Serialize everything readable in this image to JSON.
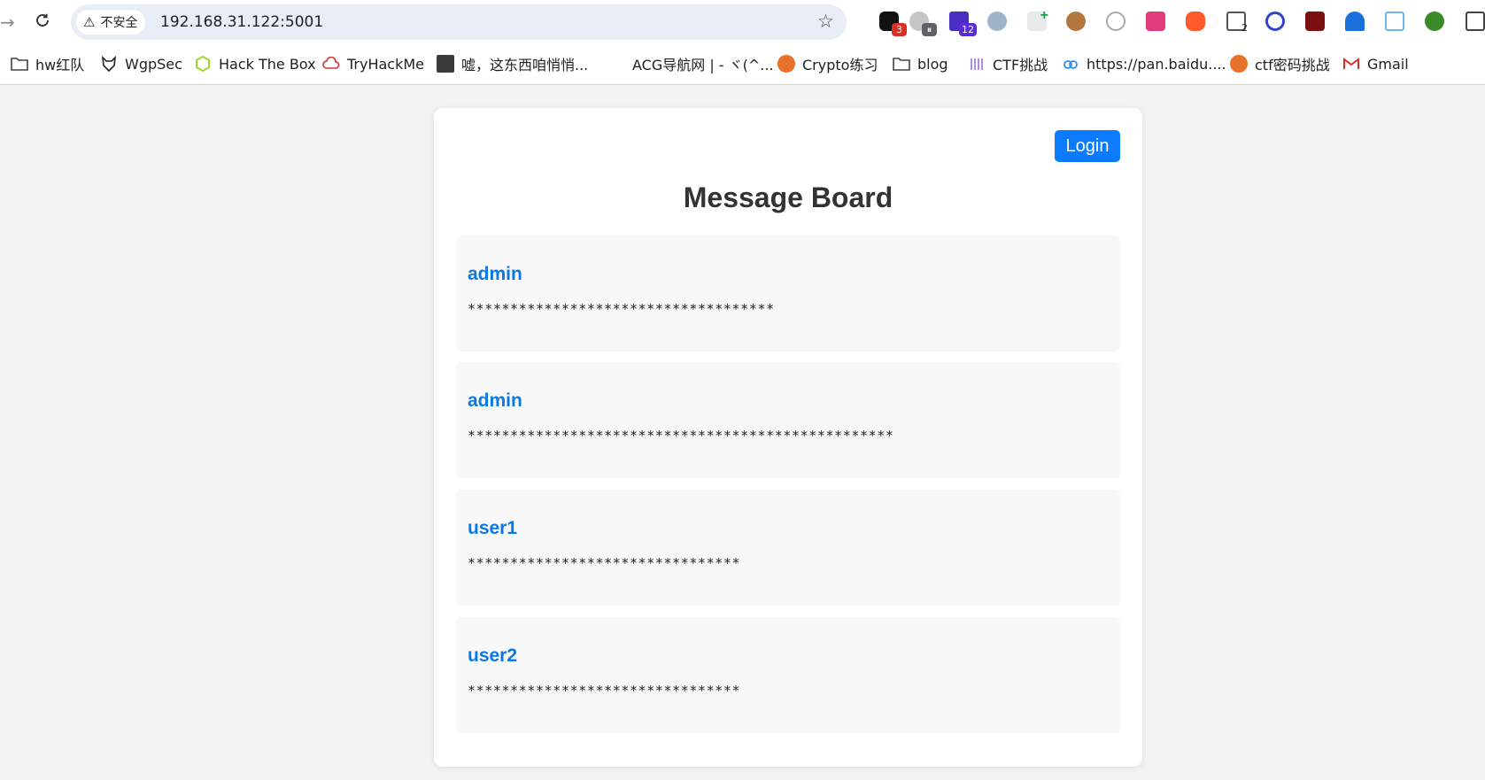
{
  "browser": {
    "security_label": "不安全",
    "url": "192.168.31.122:5001",
    "extensions": [
      {
        "name": "ext-1",
        "badge": "3",
        "badge_color": "#d93025"
      },
      {
        "name": "ext-2",
        "badge": "⏸",
        "badge_color": "#5f6368"
      },
      {
        "name": "ext-3",
        "badge": "12",
        "badge_color": "#5b2bd6"
      }
    ]
  },
  "bookmarks": [
    {
      "label": "hw红队",
      "icon": "folder-icon"
    },
    {
      "label": "WgpSec",
      "icon": "wolf-icon"
    },
    {
      "label": "Hack The Box",
      "icon": "cube-icon"
    },
    {
      "label": "TryHackMe",
      "icon": "cloud-icon"
    },
    {
      "label": "嘘，这东西咱悄悄...",
      "icon": "page-icon"
    },
    {
      "label": "ACG导航网 | - ヾ(^...",
      "icon": ""
    },
    {
      "label": "Crypto练习",
      "icon": "brain-icon"
    },
    {
      "label": "blog",
      "icon": "folder-icon"
    },
    {
      "label": "CTF挑战",
      "icon": "bars-icon"
    },
    {
      "label": "https://pan.baidu....",
      "icon": "baidu-pan-icon"
    },
    {
      "label": "ctf密码挑战",
      "icon": "brain-icon"
    },
    {
      "label": "Gmail",
      "icon": "gmail-icon"
    }
  ],
  "page": {
    "login_label": "Login",
    "title": "Message Board",
    "messages": [
      {
        "user": "admin",
        "text": "************************************"
      },
      {
        "user": "admin",
        "text": "**************************************************"
      },
      {
        "user": "user1",
        "text": "********************************"
      },
      {
        "user": "user2",
        "text": "********************************"
      }
    ]
  },
  "colors": {
    "accent": "#0a7bff",
    "username": "#0b78e3",
    "page_bg": "#f2f2f2",
    "card_bg": "#ffffff",
    "message_bg": "#f8f8f8"
  }
}
